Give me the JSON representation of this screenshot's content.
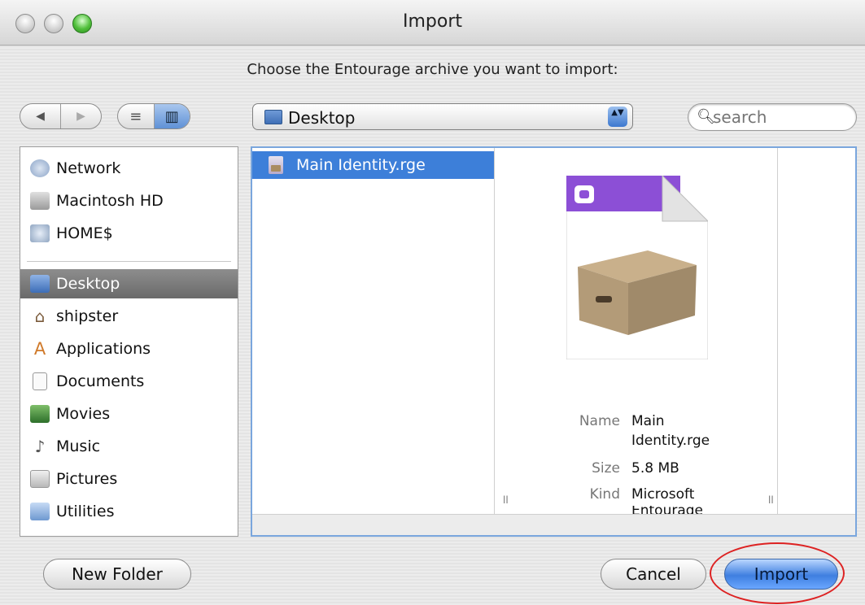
{
  "window": {
    "title": "Import"
  },
  "prompt": "Choose the Entourage archive you want to import:",
  "toolbar": {
    "back_arrow": "◀",
    "forward_arrow": "▶",
    "list_view_glyph": "≡",
    "column_view_glyph": "▥",
    "location_label": "Desktop",
    "stepper_glyph": "▲▼"
  },
  "search": {
    "placeholder": "search",
    "value": ""
  },
  "sidebar": {
    "devices": [
      {
        "label": "Network",
        "icon": "network-icon"
      },
      {
        "label": "Macintosh HD",
        "icon": "harddrive-icon"
      },
      {
        "label": "HOME$",
        "icon": "server-icon"
      }
    ],
    "places": [
      {
        "label": "Desktop",
        "icon": "desktop-icon",
        "selected": true
      },
      {
        "label": "shipster",
        "icon": "home-icon"
      },
      {
        "label": "Applications",
        "icon": "applications-icon"
      },
      {
        "label": "Documents",
        "icon": "documents-icon"
      },
      {
        "label": "Movies",
        "icon": "movies-icon"
      },
      {
        "label": "Music",
        "icon": "music-icon"
      },
      {
        "label": "Pictures",
        "icon": "pictures-icon"
      },
      {
        "label": "Utilities",
        "icon": "utilities-icon"
      }
    ]
  },
  "browser": {
    "files": [
      {
        "name": "Main Identity.rge",
        "icon": "rge-archive-icon",
        "selected": true
      }
    ],
    "preview": {
      "name_key": "Name",
      "name_value_line1": "Main",
      "name_value_line2": "Identity.rge",
      "size_key": "Size",
      "size_value": "5.8 MB",
      "kind_key": "Kind",
      "kind_value_line1": "Microsoft",
      "kind_value_line2": "Entourage"
    }
  },
  "buttons": {
    "new_folder": "New Folder",
    "cancel": "Cancel",
    "import": "Import"
  },
  "colors": {
    "selection_blue": "#3d7fd9",
    "sidebar_selected": "#7a7a7a",
    "annotation_red": "#d22222"
  }
}
